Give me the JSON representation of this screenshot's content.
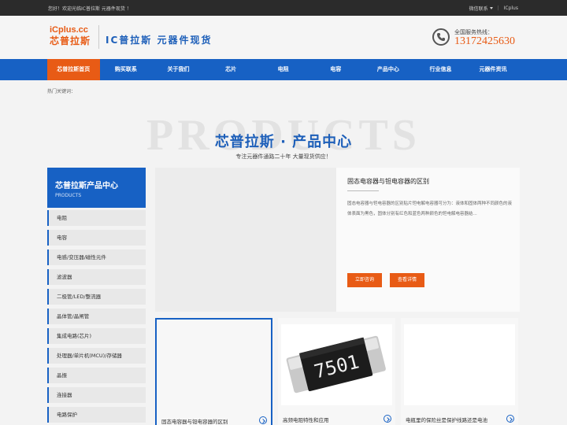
{
  "topbar": {
    "welcome": "您好！欢迎光临IC普拉斯 元器件现货 ！",
    "wechat": "微信联系",
    "brand": "ICplus"
  },
  "header": {
    "logo_en": "iCplus.cc",
    "logo_cn": "芯普拉斯",
    "slogan": "IC普拉斯 元器件现货",
    "phone_label": "全国服务热线：",
    "phone_number": "13172425630"
  },
  "nav": {
    "items": [
      {
        "label": "芯普拉斯首页",
        "active": true
      },
      {
        "label": "购买联系"
      },
      {
        "label": "关于我们"
      },
      {
        "label": "芯片"
      },
      {
        "label": "电阻"
      },
      {
        "label": "电容"
      },
      {
        "label": "产品中心"
      },
      {
        "label": "行业信息"
      },
      {
        "label": "元器件资讯"
      }
    ]
  },
  "hotwords": {
    "label": "热门关键词："
  },
  "hero": {
    "bg_text": "PRODUCTS",
    "title": "芯普拉斯 · 产品中心",
    "subtitle": "专注元器件通路二十年 大量现货供应！"
  },
  "sidebar": {
    "title": "芯普拉斯产品中心",
    "subtitle": "PRODUCTS",
    "items": [
      "电阻",
      "电容",
      "电感/变压器/磁性元件",
      "滤波器",
      "二极管/LED/整流器",
      "晶体管/晶闸管",
      "集成电路(芯片)",
      "处理器/单片机(MCU)/存储器",
      "晶振",
      "连接器",
      "电路保护"
    ]
  },
  "featured": {
    "title": "固态电容器与钽电容器的区别",
    "description": "固态电容器与钽电容器的区别贴片钽电解电容器可分为：液体和固体两种不同颜色的液体表面为黑色，固体分别有红色和蓝色两种颜色的钽电解电容器结...",
    "consult_label": "立即咨询",
    "detail_label": "查看详情"
  },
  "cards": [
    {
      "caption": "固态电容器与钽电容器的区别"
    },
    {
      "caption": "高频电阻特性和应用",
      "chip_text": "7501"
    },
    {
      "caption": "电瓶里的保险丝是保护线路还是电池"
    }
  ],
  "colors": {
    "brand_blue": "#1761c4",
    "brand_orange": "#e85b15"
  }
}
